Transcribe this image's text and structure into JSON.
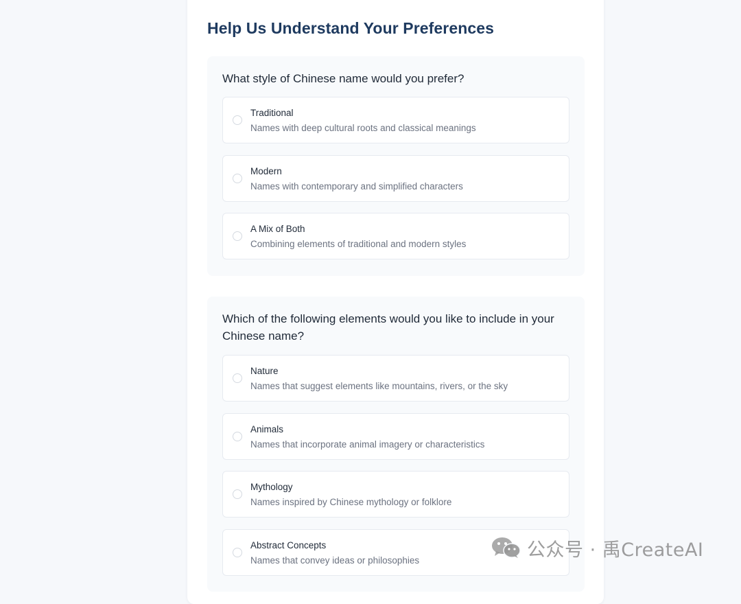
{
  "page": {
    "title": "Help Us Understand Your Preferences"
  },
  "questions": [
    {
      "text": "What style of Chinese name would you prefer?",
      "options": [
        {
          "label": "Traditional",
          "description": "Names with deep cultural roots and classical meanings"
        },
        {
          "label": "Modern",
          "description": "Names with contemporary and simplified characters"
        },
        {
          "label": "A Mix of Both",
          "description": "Combining elements of traditional and modern styles"
        }
      ]
    },
    {
      "text": "Which of the following elements would you like to include in your Chinese name?",
      "options": [
        {
          "label": "Nature",
          "description": "Names that suggest elements like mountains, rivers, or the sky"
        },
        {
          "label": "Animals",
          "description": "Names that incorporate animal imagery or characteristics"
        },
        {
          "label": "Mythology",
          "description": "Names inspired by Chinese mythology or folklore"
        },
        {
          "label": "Abstract Concepts",
          "description": "Names that convey ideas or philosophies"
        }
      ]
    }
  ],
  "watermark": {
    "icon": "wechat-icon",
    "text": "公众号 · 禹CreateAI"
  },
  "colors": {
    "title": "#1e3a5f",
    "background": "#f6f8fb",
    "question_bg": "#f8fafc",
    "option_border": "#e6eaf0",
    "text_primary": "#1f2937",
    "text_secondary": "#6b7280"
  }
}
